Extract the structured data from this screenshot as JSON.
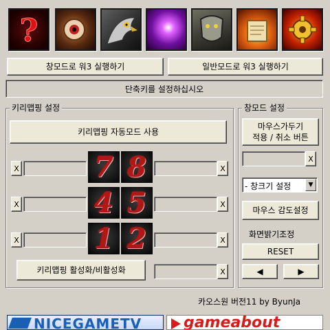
{
  "top_buttons": {
    "window_mode_run": "창모드로 워3 실행하기",
    "normal_mode_run": "일반모드로 워3 실행하기"
  },
  "status_bar": {
    "message": "단축키를 설정하십시오"
  },
  "keymap_group": {
    "label": "키리맵핑 설정",
    "auto_mode_button": "키리맵핑 자동모드 사용",
    "numpad_keys": [
      "7",
      "8",
      "4",
      "5",
      "1",
      "2"
    ],
    "clear_label": "X",
    "toggle_button": "키리맵핑 활성화/비활성화"
  },
  "window_group": {
    "label": "창모드 설정",
    "mouse_confine_button_line1": "마우스가두기",
    "mouse_confine_button_line2": "적용 / 취소 버튼",
    "window_size_select": "- 창크기 설정",
    "mouse_sensitivity_button": "마우스 감도설정",
    "brightness_label": "화면밝기조정",
    "reset_button": "RESET",
    "left_arrow": "◀",
    "right_arrow": "▶"
  },
  "footer": {
    "credit": "카오스원 버전11  by ByunJa",
    "banner_left": "NICEGAMETV",
    "banner_right": "gameabout"
  },
  "colors": {
    "background": "#d4d0c8",
    "numpad_red": "#b01818",
    "banner_blue": "#1a5fb4",
    "banner_red": "#d81c1c"
  },
  "icons": [
    "help-icon",
    "eye-icon",
    "eagle-icon",
    "magic-spark-icon",
    "armor-icon",
    "scroll-fire-icon",
    "gear-fire-icon"
  ]
}
